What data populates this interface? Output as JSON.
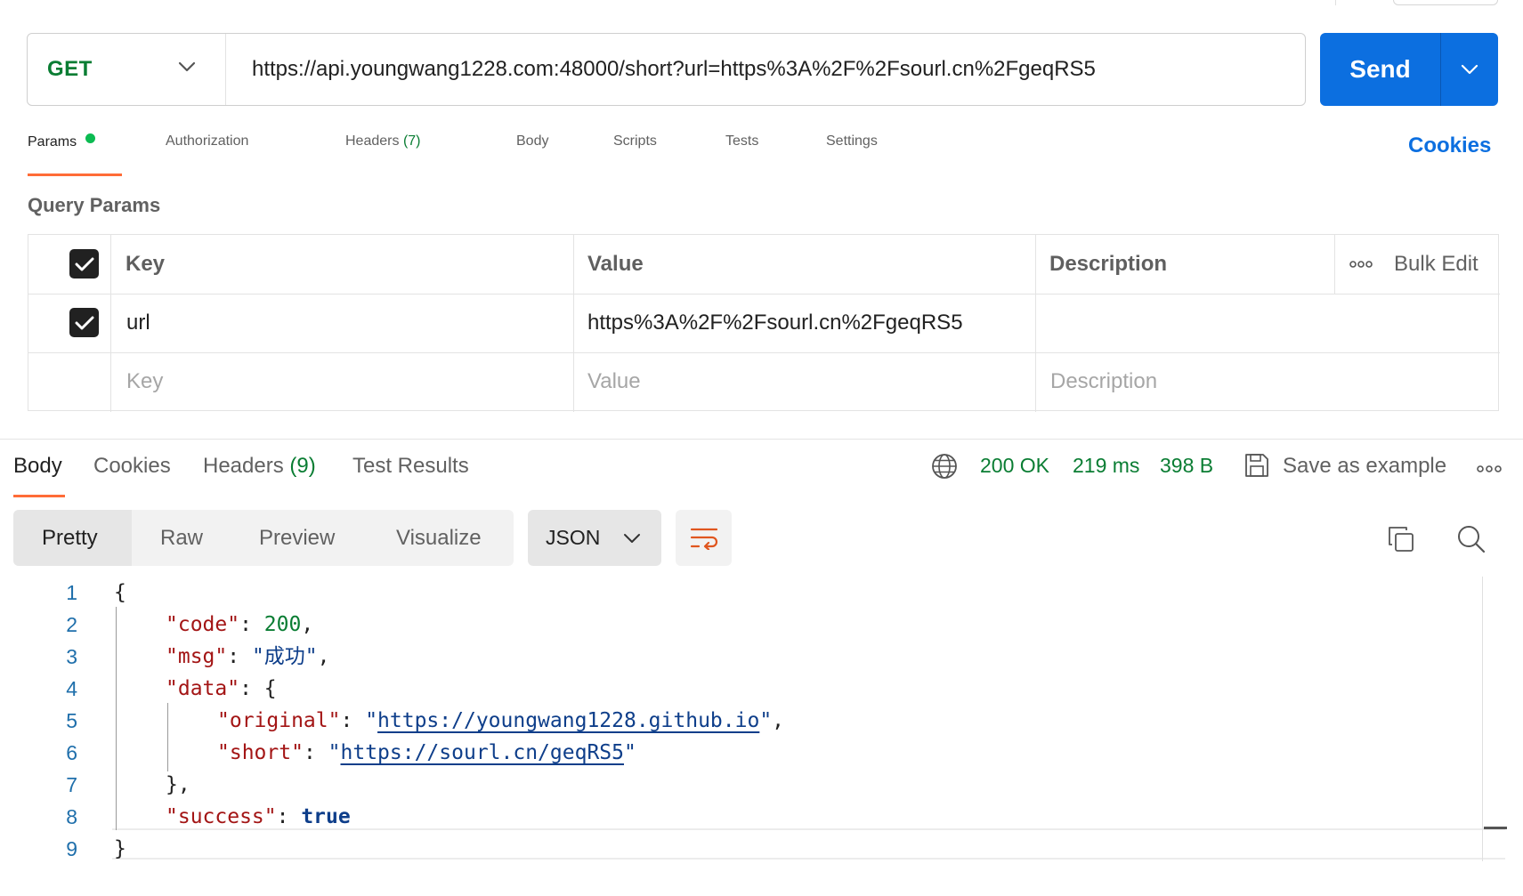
{
  "request": {
    "method": "GET",
    "url": "https://api.youngwang1228.com:48000/short?url=https%3A%2F%2Fsourl.cn%2FgeqRS5",
    "send_label": "Send"
  },
  "request_tabs": {
    "params": "Params",
    "authorization": "Authorization",
    "headers": "Headers",
    "headers_count": "(7)",
    "body": "Body",
    "scripts": "Scripts",
    "tests": "Tests",
    "settings": "Settings",
    "cookies": "Cookies"
  },
  "query_params": {
    "title": "Query Params",
    "headers": {
      "key": "Key",
      "value": "Value",
      "description": "Description",
      "bulk_edit": "Bulk Edit"
    },
    "rows": [
      {
        "checked": true,
        "key": "url",
        "value": "https%3A%2F%2Fsourl.cn%2FgeqRS5",
        "description": ""
      }
    ],
    "placeholder": {
      "key": "Key",
      "value": "Value",
      "description": "Description"
    }
  },
  "response": {
    "tabs": {
      "body": "Body",
      "cookies": "Cookies",
      "headers": "Headers",
      "headers_count": "(9)",
      "test_results": "Test Results"
    },
    "status": "200 OK",
    "time": "219 ms",
    "size": "398 B",
    "save_example": "Save as example",
    "views": {
      "pretty": "Pretty",
      "raw": "Raw",
      "preview": "Preview",
      "visualize": "Visualize"
    },
    "format": "JSON",
    "line_numbers": [
      "1",
      "2",
      "3",
      "4",
      "5",
      "6",
      "7",
      "8",
      "9"
    ],
    "body": {
      "open": "{",
      "code_key": "\"code\"",
      "code_val": "200",
      "msg_key": "\"msg\"",
      "msg_val": "\"成功\"",
      "data_key": "\"data\"",
      "data_open": "{",
      "original_key": "\"original\"",
      "original_val": "https://youngwang1228.github.io",
      "short_key": "\"short\"",
      "short_val": "https://sourl.cn/geqRS5",
      "data_close": "},",
      "success_key": "\"success\"",
      "success_val": "true",
      "close": "}"
    }
  },
  "colors": {
    "accent": "#0c6fe0",
    "method_green": "#0a7d33",
    "tab_underline": "#ff6c37",
    "json_key": "#a31515",
    "json_string": "#0e3e8a"
  }
}
